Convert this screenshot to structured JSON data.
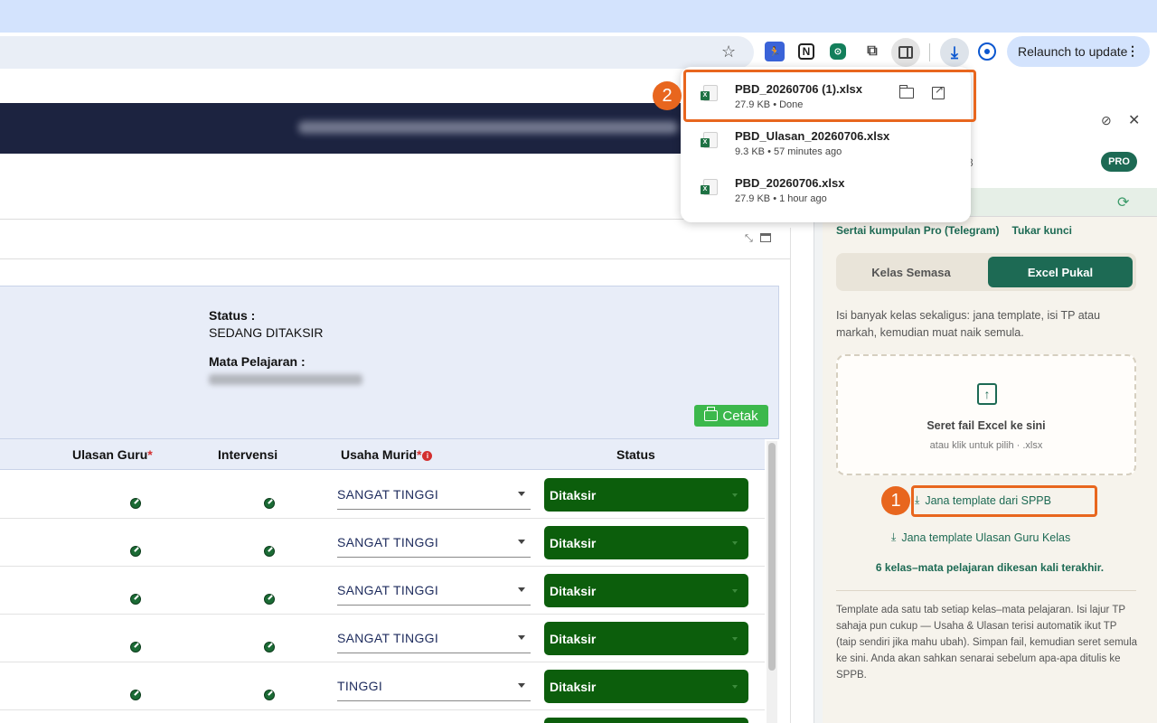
{
  "browser": {
    "relaunch_label": "Relaunch to update",
    "relaunch_menu": "⋮",
    "star_glyph": "☆",
    "extensions": [
      {
        "name": "runner-extension-icon",
        "glyph": "🏃"
      },
      {
        "name": "notion-icon",
        "glyph": "N"
      },
      {
        "name": "green-extension-icon",
        "glyph": "⊙"
      },
      {
        "name": "puzzle-icon",
        "glyph": "⧉"
      }
    ]
  },
  "downloads": {
    "items": [
      {
        "name": "PBD_20260706 (1).xlsx",
        "meta": "27.9 KB • Done"
      },
      {
        "name": "PBD_Ulasan_20260706.xlsx",
        "meta": "9.3 KB • 57 minutes ago"
      },
      {
        "name": "PBD_20260706.xlsx",
        "meta": "27.9 KB • 1 hour ago"
      }
    ]
  },
  "page": {
    "status_label": "Status :",
    "status_value": "SEDANG DITAKSIR",
    "subject_label": "Mata Pelajaran :",
    "print_label": "Cetak",
    "columns": {
      "ulasan": "Ulasan Guru",
      "ulasan_req": "*",
      "intervensi": "Intervensi",
      "usaha": "Usaha Murid",
      "usaha_req": "*",
      "info_glyph": "i",
      "status": "Status"
    },
    "rows": [
      {
        "usaha": "SANGAT TINGGI",
        "status": "Ditaksir"
      },
      {
        "usaha": "SANGAT TINGGI",
        "status": "Ditaksir"
      },
      {
        "usaha": "SANGAT TINGGI",
        "status": "Ditaksir"
      },
      {
        "usaha": "SANGAT TINGGI",
        "status": "Ditaksir"
      },
      {
        "usaha": "TINGGI",
        "status": "Ditaksir"
      },
      {
        "usaha": "",
        "status": ""
      }
    ]
  },
  "panel": {
    "pro_badge": "PRO",
    "header_fragment": "3",
    "links": [
      "Sertai kumpulan Pro (Telegram)",
      "Tukar kunci"
    ],
    "tabs": [
      "Kelas Semasa",
      "Excel Pukal"
    ],
    "description": "Isi banyak kelas sekaligus: jana template, isi TP atau markah, kemudian muat naik semula.",
    "dropzone_title": "Seret fail Excel ke sini",
    "dropzone_sub": "atau klik untuk pilih · .xlsx",
    "template_button": "Jana template dari SPPB",
    "template_ulasan_button": "Jana template Ulasan Guru Kelas",
    "recent_note": "6 kelas–mata pelajaran dikesan kali terakhir.",
    "footer_note": "Template ada satu tab setiap kelas–mata pelajaran. Isi lajur TP sahaja pun cukup — Usaha & Ulasan terisi automatik ikut TP (taip sendiri jika mahu ubah). Simpan fail, kemudian seret semula ke sini. Anda akan sahkan senarai sebelum apa-apa ditulis ke SPPB."
  },
  "annotations": {
    "step1": "1",
    "step2": "2",
    "color": "#e8661e"
  },
  "colors": {
    "accent_green": "#1d6a54",
    "status_green": "#0c5e0c",
    "navbar": "#1c2340",
    "chrome_blue": "#d3e3fd"
  }
}
